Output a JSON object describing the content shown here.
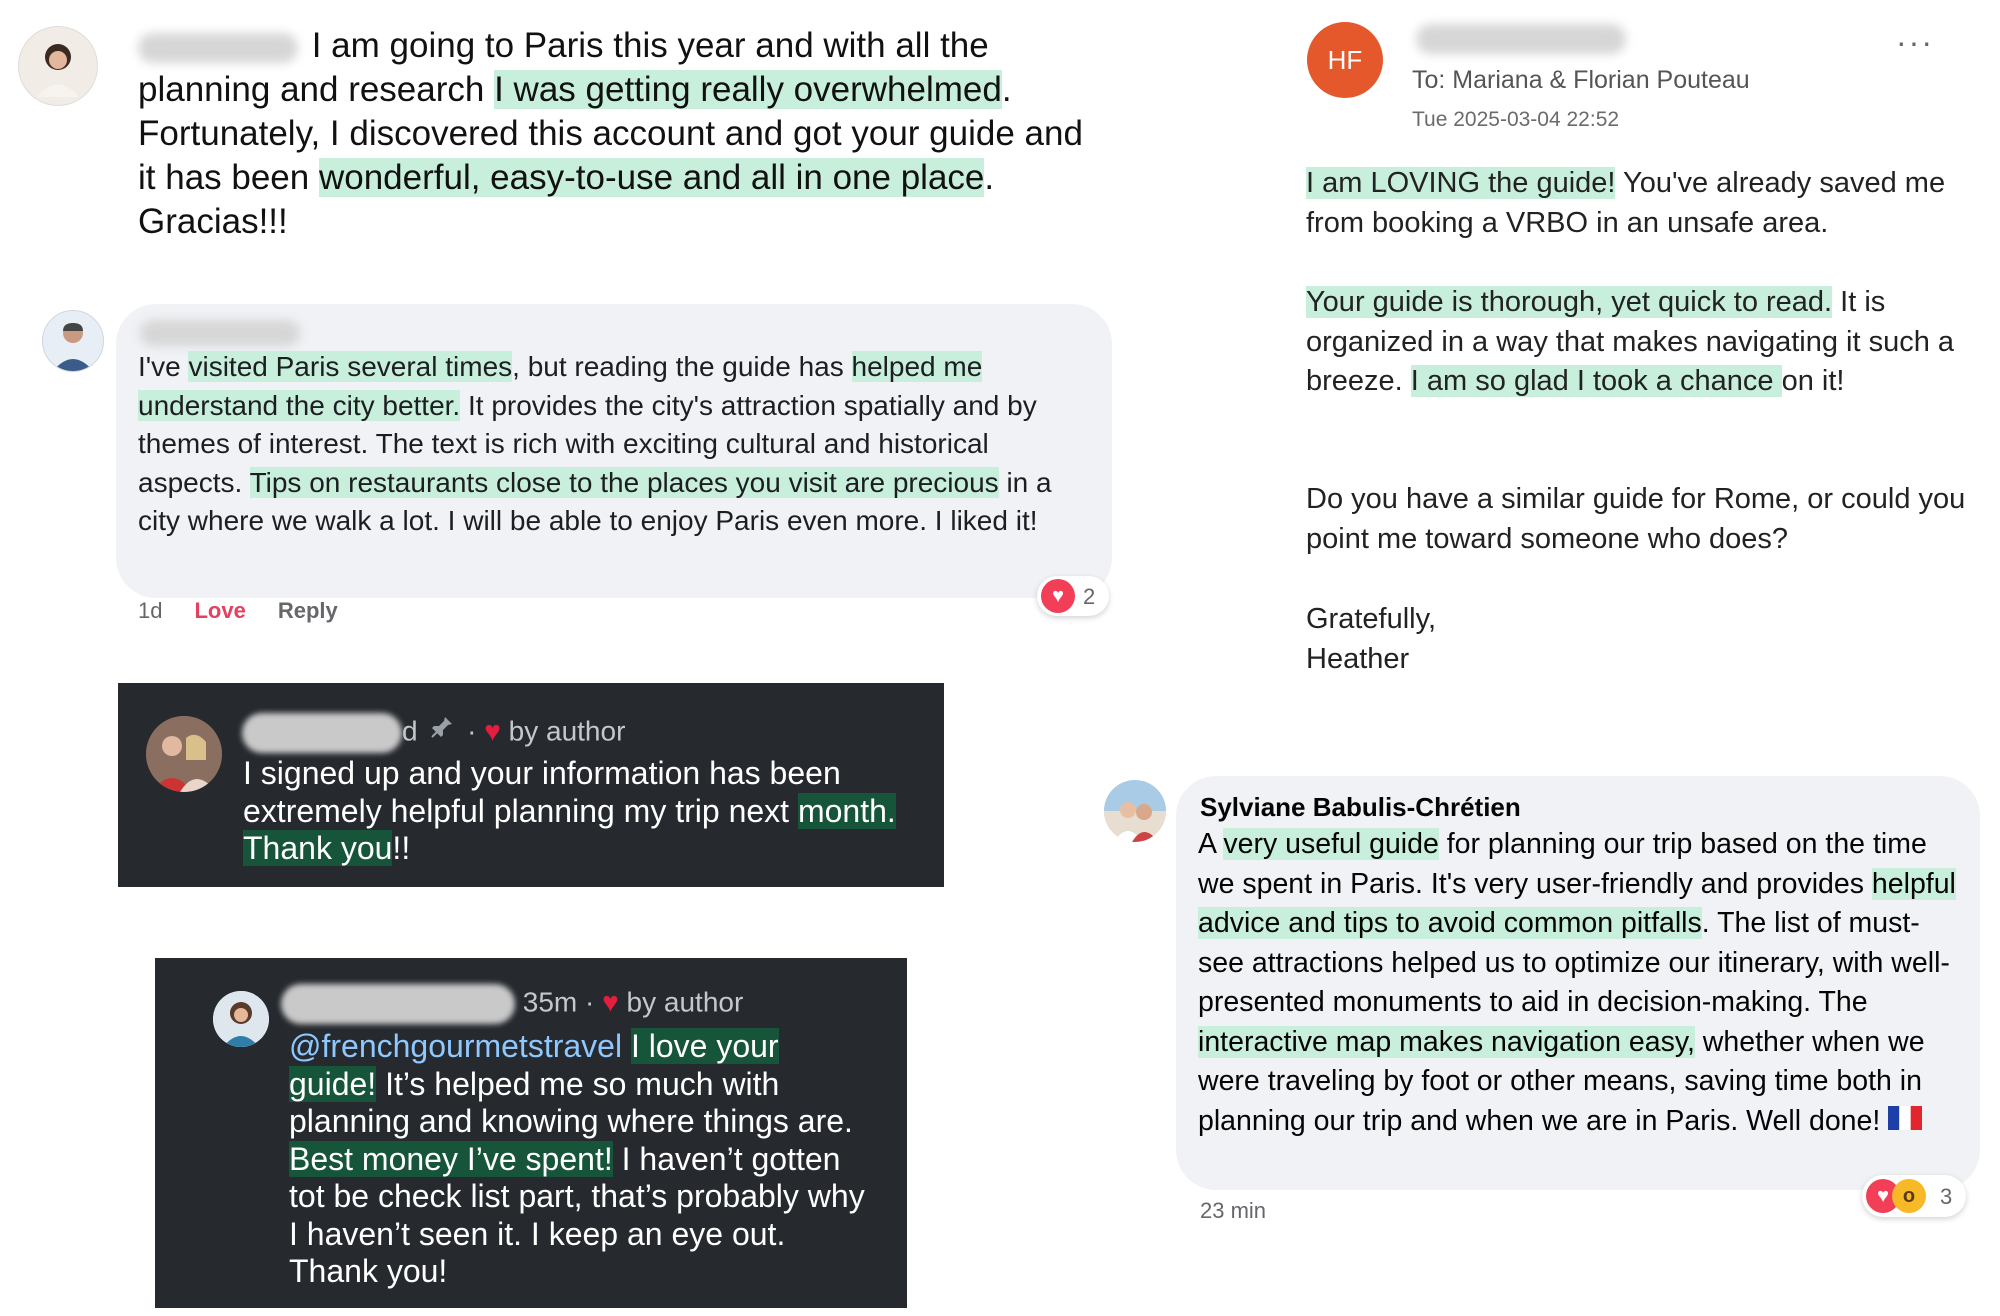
{
  "review1": {
    "p1": " I am going to Paris this year and with all the planning and research ",
    "h1": "I was getting really overwhelmed",
    "p2": ". Fortunately, I discovered this account and got your guide and it has been ",
    "h2": "wonderful, easy-to-use and all in one place",
    "p3": ". Gracias!!!"
  },
  "review2": {
    "p1": "I've ",
    "h1": "visited Paris several times",
    "p2": ", but reading the guide has ",
    "h2": "helped me understand the city better.",
    "p3": " It provides the city's attraction spatially and by themes of interest. The text is rich with exciting cultural and historical aspects. ",
    "h3": "Tips on restaurants close to the places you visit are precious",
    "p4": " in a city where we walk a lot. I will be able to enjoy Paris even more. I liked it!",
    "time": "1d",
    "love_label": "Love",
    "reply_label": "Reply",
    "reaction_count": "2"
  },
  "dark1": {
    "meta_time": "d",
    "meta_sep": "·",
    "by_author": "by author",
    "text1": "I signed up and your information has been extremely helpful planning my trip next ",
    "h1": "month. Thank you",
    "text2": "!!"
  },
  "dark2": {
    "meta_time": "35m",
    "meta_sep": "·",
    "by_author": "by author",
    "mention": "@frenchgourmetstravel",
    "h1": "I love your guide!",
    "p1": " It’s helped me so much with planning and knowing where things are. ",
    "h2": "Best money I’ve spent!",
    "p2": " I haven’t gotten tot be check list part, that’s probably why I haven’t seen it. I keep an eye out. Thank you!"
  },
  "email": {
    "avatar_initials": "HF",
    "to": "To: Mariana & Florian Pouteau",
    "date": "Tue 2025-03-04 22:52",
    "more": "···",
    "p1_h": "I am LOVING the guide!",
    "p1": " You've already saved me from booking a VRBO in an unsafe area.",
    "p2_h": "Your guide is thorough, yet quick to read.",
    "p2a": " It is organized in a way that makes navigating it such a breeze. ",
    "p2_h2": "I am so glad I took a chance ",
    "p2b": "on it!",
    "p3": "Do you have a similar guide for Rome, or could you point me toward someone who does?",
    "p4a": "Gratefully,",
    "p4b": "Heather"
  },
  "review4": {
    "name": "Sylviane Babulis-Chrétien",
    "p1": "A ",
    "h1": "very useful guide",
    "p2": " for planning our trip based on the time we spent in Paris. It's very user-friendly and provides ",
    "h2": "helpful advice and tips to avoid common pitfalls",
    "p3": ". The list of must-see attractions helped us to optimize our itinerary, with well-presented monuments to aid in decision-making. The ",
    "h3": "interactive map makes navigation easy,",
    "p4": " whether when we were traveling by foot or other means, saving time both in planning our trip and when we are in Paris. Well done! ",
    "time": "23 min",
    "reaction_count": "3"
  },
  "colors": {
    "highlight": "#c8efdc",
    "highlight_dark": "#16553a",
    "dark_card": "#262a2f",
    "love": "#e4405f",
    "email_avatar": "#e4582b"
  },
  "icons": [
    "heart-icon",
    "pin-icon",
    "more-icon",
    "flag-icon",
    "wow-icon"
  ]
}
